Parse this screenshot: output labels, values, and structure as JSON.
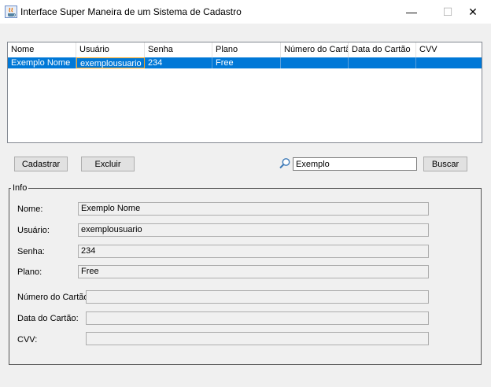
{
  "window": {
    "title": "Interface Super Maneira de um Sistema de Cadastro",
    "minimize": "—",
    "maximize": "☐",
    "close": "✕"
  },
  "table": {
    "columns": [
      "Nome",
      "Usuário",
      "Senha",
      "Plano",
      "Número do Cartão",
      "Data do Cartão",
      "CVV"
    ],
    "rows": [
      [
        "Exemplo Nome",
        "exemplousuario",
        "234",
        "Free",
        "",
        "",
        ""
      ]
    ]
  },
  "actions": {
    "cadastrar": "Cadastrar",
    "excluir": "Excluir",
    "buscar": "Buscar"
  },
  "search": {
    "value": "Exemplo"
  },
  "info": {
    "title": "Info",
    "labels": {
      "nome": "Nome:",
      "usuario": "Usuário:",
      "senha": "Senha:",
      "plano": "Plano:",
      "numero_cartao": "Número do Cartão:",
      "data_cartao": "Data do Cartão:",
      "cvv": "CVV:"
    },
    "values": {
      "nome": "Exemplo Nome",
      "usuario": "exemplousuario",
      "senha": "234",
      "plano": "Free",
      "numero_cartao": "",
      "data_cartao": "",
      "cvv": ""
    }
  },
  "colors": {
    "selection": "#0078d7",
    "focus_border": "#f5a623"
  }
}
